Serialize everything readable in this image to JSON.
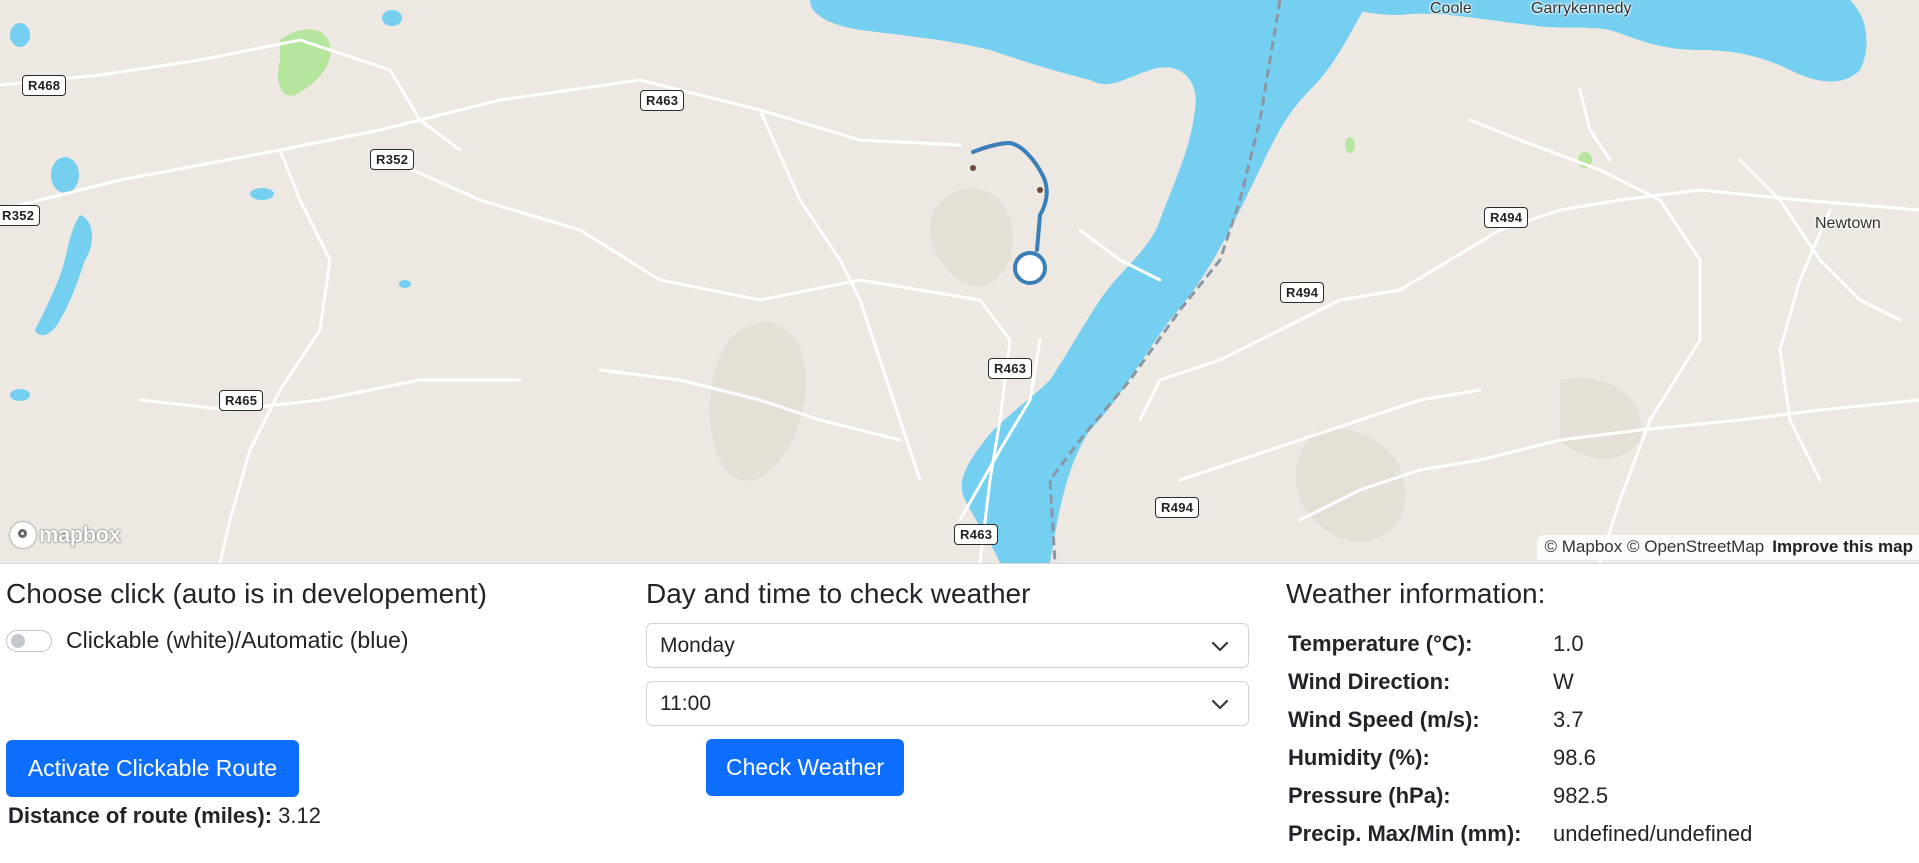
{
  "map": {
    "road_labels": [
      "R468",
      "R463",
      "R352",
      "R352",
      "R465",
      "R463",
      "R463",
      "R494",
      "R494",
      "R494"
    ],
    "place_labels": [
      "Coole",
      "Garrykennedy",
      "Newtown"
    ],
    "logo_text": "mapbox",
    "attribution": "© Mapbox © OpenStreetMap",
    "improve_link": "Improve this map",
    "colors": {
      "land": "#ede9e2",
      "water": "#75cff0",
      "park": "#b6e59e",
      "route": "#3a7fb8"
    }
  },
  "controls": {
    "click_section_title": "Choose click (auto is in developement)",
    "toggle_label": "Clickable (white)/Automatic (blue)",
    "toggle_checked": false,
    "activate_button": "Activate Clickable Route",
    "distance_label": "Distance of route (miles):",
    "distance_value": "3.12"
  },
  "weather_query": {
    "title": "Day and time to check weather",
    "day_selected": "Monday",
    "time_selected": "11:00",
    "check_button": "Check Weather"
  },
  "weather_info": {
    "title": "Weather information:",
    "rows": [
      {
        "label": "Temperature (°C):",
        "value": "1.0"
      },
      {
        "label": "Wind Direction:",
        "value": "W"
      },
      {
        "label": "Wind Speed (m/s):",
        "value": "3.7"
      },
      {
        "label": "Humidity (%):",
        "value": "98.6"
      },
      {
        "label": "Pressure (hPa):",
        "value": "982.5"
      },
      {
        "label": "Precip. Max/Min (mm):",
        "value": "undefined/undefined"
      }
    ]
  }
}
